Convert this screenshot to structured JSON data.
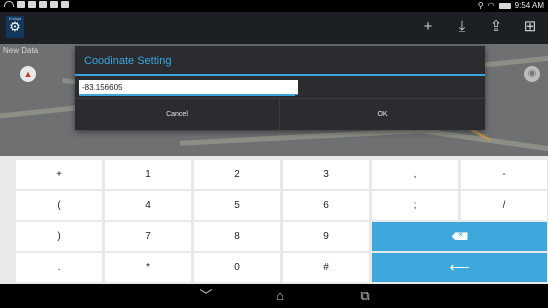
{
  "status_bar": {
    "time": "9:54 AM",
    "left_icons": [
      "wifi-icon",
      "signal-icon",
      "document-icon",
      "image-icon",
      "mail-icon",
      "briefcase-icon"
    ],
    "right_icons": [
      "location-icon",
      "wifi-icon",
      "battery-icon"
    ]
  },
  "action_bar": {
    "app_badge": "Ehitaja",
    "icons": [
      "plus-icon",
      "download-icon",
      "upload-icon",
      "image-add-icon"
    ],
    "icon_glyphs": [
      "+",
      "⤓",
      "⇪",
      "⊞"
    ]
  },
  "map": {
    "layer_label": "New Data"
  },
  "dialog": {
    "title": "Coodinate Setting",
    "input_value": "-83.156605",
    "cancel_label": "Cancel",
    "ok_label": "OK",
    "accent_color": "#3aa6dc"
  },
  "keyboard": {
    "rows": [
      [
        "+",
        "1",
        "2",
        "3",
        ",",
        "-"
      ],
      [
        "(",
        "4",
        "5",
        "6",
        ";",
        "/"
      ],
      [
        ")",
        "7",
        "8",
        "9",
        "",
        ""
      ],
      [
        ".",
        "*",
        "0",
        "#",
        "",
        ""
      ]
    ],
    "backspace_icon": "backspace-icon",
    "enter_icon": "enter-icon",
    "accent_color": "#3ea8dc"
  },
  "nav_bar": {
    "icons": [
      "back-chevron-icon",
      "home-icon",
      "recent-apps-icon"
    ],
    "glyphs": [
      "﹀",
      "⌂",
      "⧉"
    ]
  }
}
